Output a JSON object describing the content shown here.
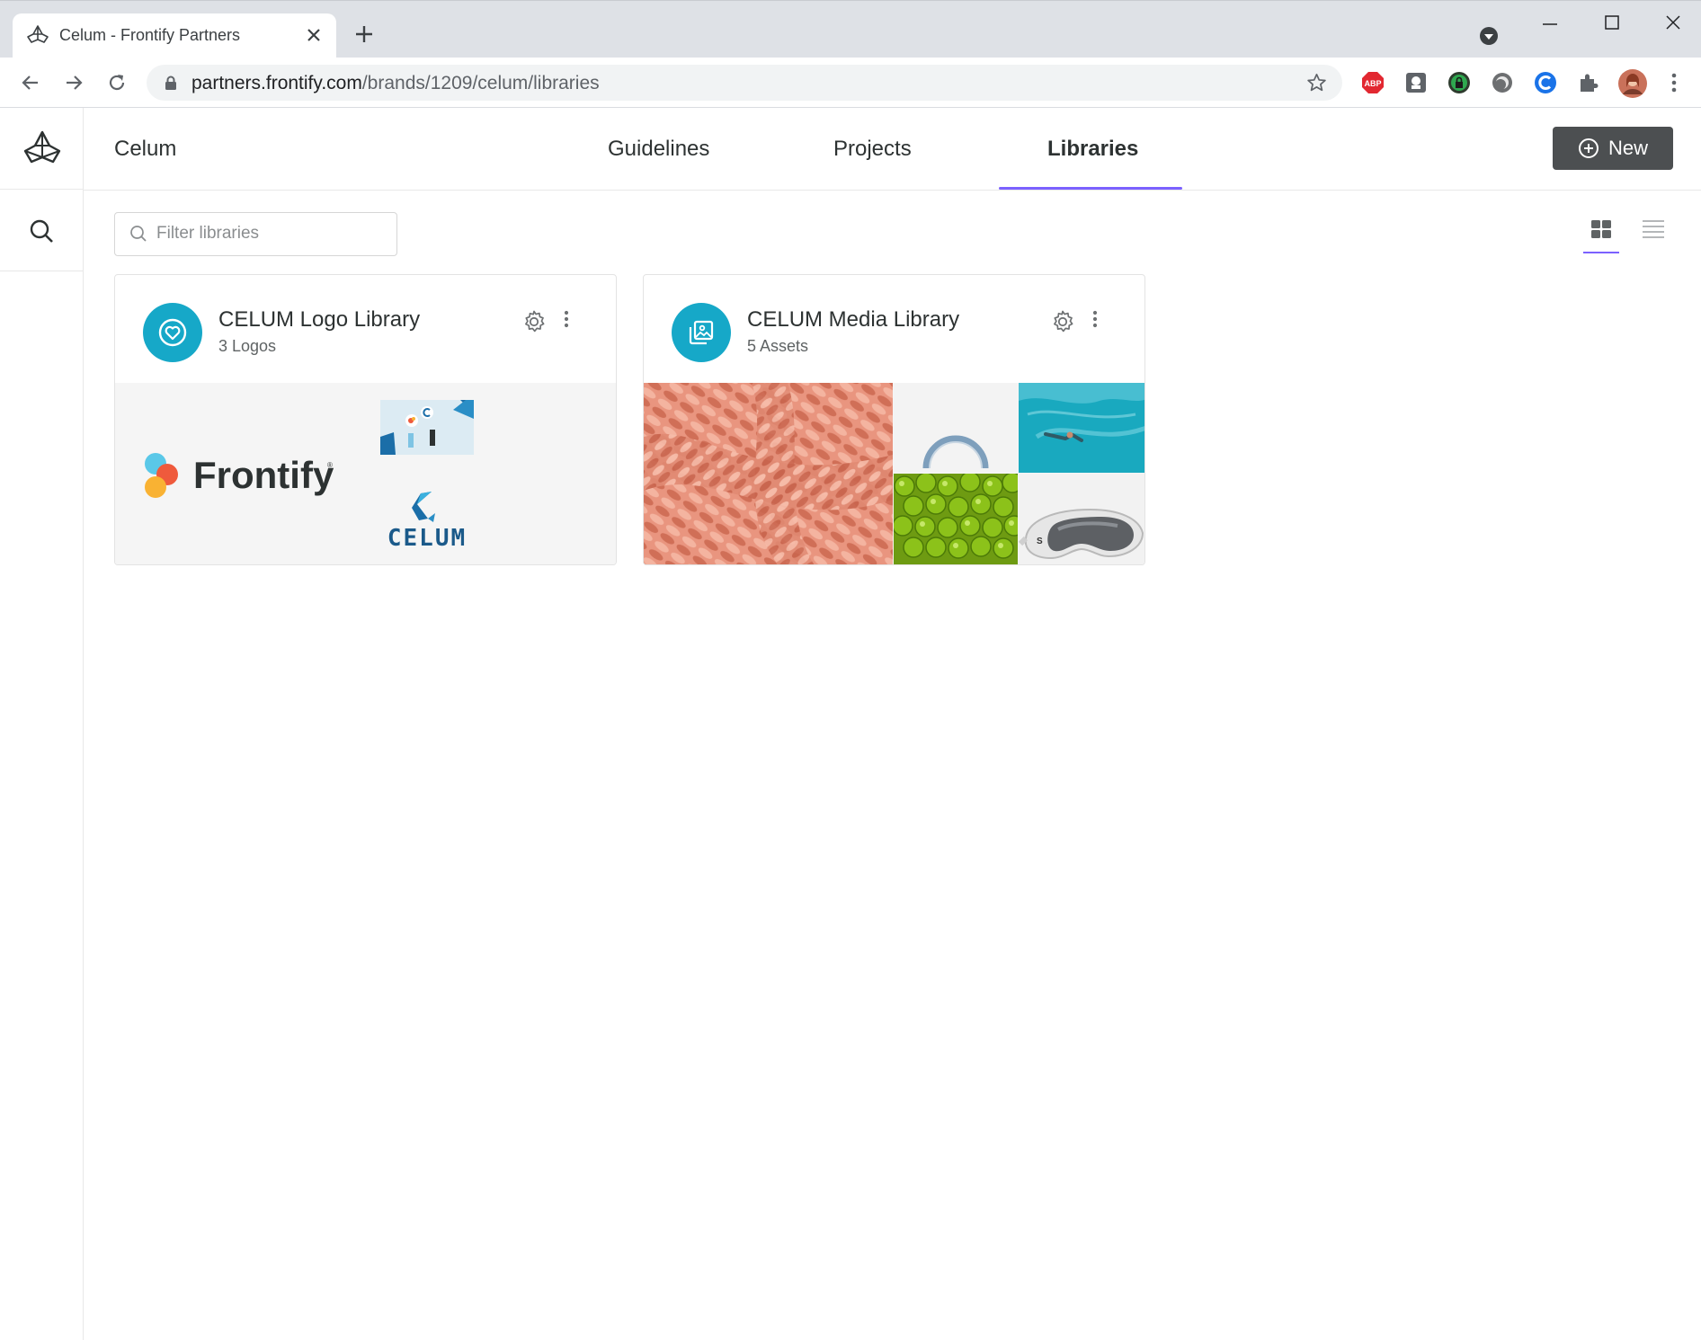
{
  "browser": {
    "tab_title": "Celum - Frontify Partners",
    "url_host": "partners.frontify.com",
    "url_path": "/brands/1209/celum/libraries",
    "extensions": [
      "abp-icon",
      "shield-ext-icon",
      "lock-ext-icon",
      "circle-ext-icon",
      "c-ext-icon",
      "puzzle-icon"
    ],
    "abp_label": "ABP"
  },
  "header": {
    "brand": "Celum",
    "nav": [
      {
        "label": "Guidelines",
        "active": false
      },
      {
        "label": "Projects",
        "active": false
      },
      {
        "label": "Libraries",
        "active": true
      }
    ],
    "new_button": "New"
  },
  "filter": {
    "placeholder": "Filter libraries"
  },
  "libraries": [
    {
      "title": "CELUM Logo Library",
      "subtitle": "3 Logos",
      "icon": "heart-icon",
      "thumbs": [
        "frontify-logo",
        "celum-illustration",
        "celum-logo"
      ],
      "frontify_text": "Frontify",
      "celum_text": "CELUM"
    },
    {
      "title": "CELUM Media Library",
      "subtitle": "5 Assets",
      "icon": "images-icon",
      "thumbs": [
        "coral-rope-photo",
        "ring-photo",
        "underwater-swimmer-photo",
        "limes-photo",
        "ski-goggles-photo"
      ]
    }
  ],
  "colors": {
    "accent": "#7b61ff",
    "library_icon": "#16a8c8",
    "new_button": "#4c4f51"
  }
}
